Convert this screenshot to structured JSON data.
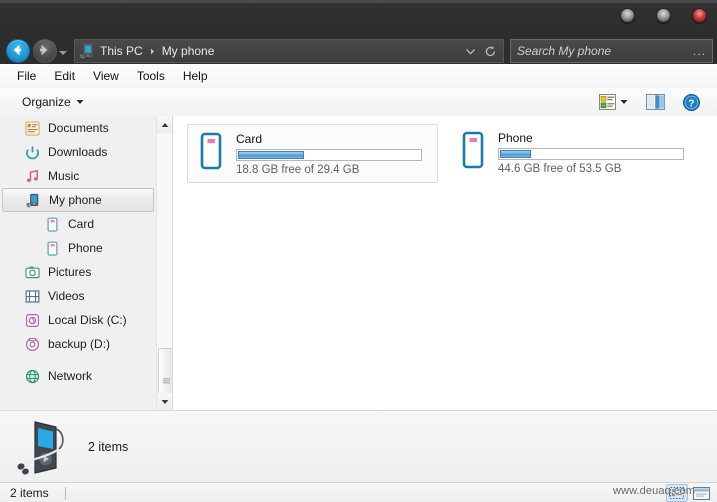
{
  "window": {
    "controls": [
      {
        "name": "minimize",
        "color": "#9a9a9a"
      },
      {
        "name": "maximize",
        "color": "#9a9a9a"
      },
      {
        "name": "close",
        "color": "#cf3a32"
      }
    ]
  },
  "nav": {
    "back_label": "Back",
    "forward_label": "Forward",
    "history_label": "Recent locations",
    "address_icon": "phone-device-icon",
    "breadcrumbs": [
      "This PC",
      "My phone"
    ],
    "chevron_label": "Previous locations",
    "refresh_label": "Refresh"
  },
  "search": {
    "placeholder": "Search My phone",
    "overflow": "..."
  },
  "menubar": {
    "items": [
      "File",
      "Edit",
      "View",
      "Tools",
      "Help"
    ]
  },
  "toolbar": {
    "organize_label": "Organize",
    "organize_icon": "chevron-down-icon",
    "view_options_icon": "view-options-icon",
    "view_dropdown_icon": "chevron-down-icon",
    "preview_pane_icon": "preview-pane-icon",
    "help_icon": "help-icon"
  },
  "sidebar": {
    "items": [
      {
        "label": "Documents",
        "icon": "documents-icon",
        "child": false,
        "selected": false
      },
      {
        "label": "Downloads",
        "icon": "downloads-icon",
        "child": false,
        "selected": false
      },
      {
        "label": "Music",
        "icon": "music-icon",
        "child": false,
        "selected": false
      },
      {
        "label": "My phone",
        "icon": "phone-device-icon",
        "child": false,
        "selected": true
      },
      {
        "label": "Card",
        "icon": "drive-icon",
        "child": true,
        "selected": false
      },
      {
        "label": "Phone",
        "icon": "drive-icon",
        "child": true,
        "selected": false
      },
      {
        "label": "Pictures",
        "icon": "pictures-icon",
        "child": false,
        "selected": false
      },
      {
        "label": "Videos",
        "icon": "videos-icon",
        "child": false,
        "selected": false
      },
      {
        "label": "Local Disk (C:)",
        "icon": "disk-icon",
        "child": false,
        "selected": false
      },
      {
        "label": "backup (D:)",
        "icon": "disk-icon",
        "child": false,
        "selected": false
      },
      {
        "label": "Network",
        "icon": "network-icon",
        "child": false,
        "selected": false,
        "gap_before": true
      }
    ],
    "scrollbar": {
      "up_icon": "scroll-up-icon",
      "down_icon": "scroll-down-icon"
    }
  },
  "content": {
    "drives": [
      {
        "name": "Card",
        "icon": "memory-card-icon",
        "free_text": "18.8 GB free of 29.4 GB",
        "free_gb": 18.8,
        "total_gb": 29.4,
        "used_percent": 36,
        "selected": true
      },
      {
        "name": "Phone",
        "icon": "memory-card-icon",
        "free_text": "44.6 GB free of 53.5 GB",
        "free_gb": 44.6,
        "total_gb": 53.5,
        "used_percent": 17,
        "selected": false
      }
    ]
  },
  "details_pane": {
    "icon": "media-player-icon",
    "text": "2 items"
  },
  "statusbar": {
    "text": "2 items",
    "view_details_icon": "details-view-icon",
    "view_icons_icon": "large-icons-view-icon"
  },
  "watermark": {
    "text": "www.deuaq.com"
  },
  "colors": {
    "accent": "#1f9ada",
    "titlebar": "#2d2d2d",
    "bar_fill": "#6aaddc",
    "selection": "#dcdcdc"
  }
}
